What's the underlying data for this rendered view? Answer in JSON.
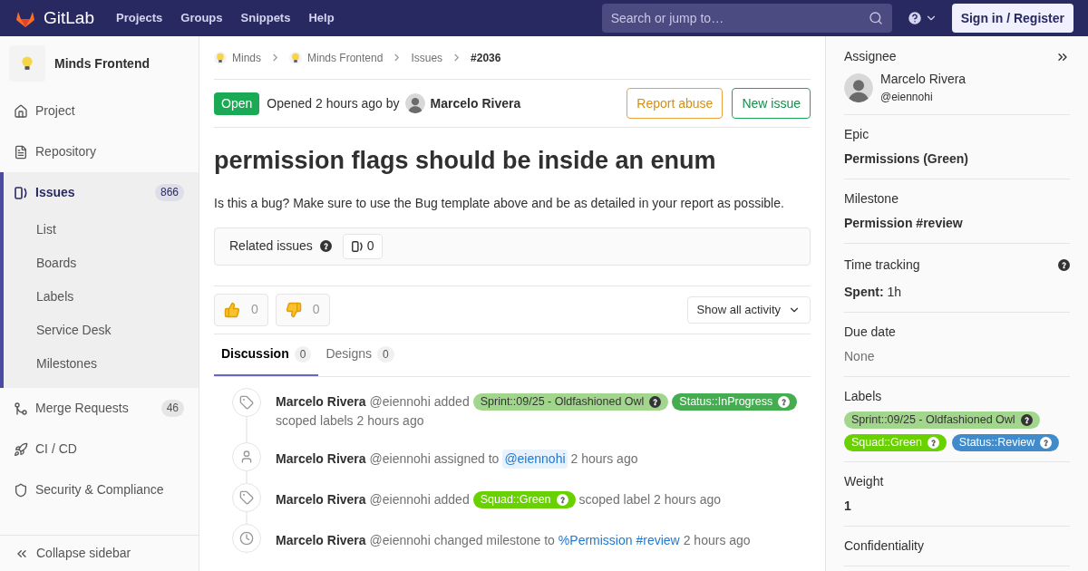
{
  "topbar": {
    "brand": "GitLab",
    "nav": [
      "Projects",
      "Groups",
      "Snippets",
      "Help"
    ],
    "search": {
      "placeholder": "Search or jump to…"
    },
    "sign_in": "Sign in / Register"
  },
  "sidebar": {
    "project": "Minds Frontend",
    "items": [
      {
        "label": "Project",
        "selected": false
      },
      {
        "label": "Repository",
        "selected": false
      },
      {
        "label": "Issues",
        "count": "866",
        "selected": true,
        "children": [
          {
            "label": "List"
          },
          {
            "label": "Boards"
          },
          {
            "label": "Labels"
          },
          {
            "label": "Service Desk"
          },
          {
            "label": "Milestones"
          }
        ]
      },
      {
        "label": "Merge Requests",
        "count": "46",
        "selected": false
      },
      {
        "label": "CI / CD",
        "selected": false
      },
      {
        "label": "Security & Compliance",
        "selected": false
      }
    ],
    "collapse": "Collapse sidebar"
  },
  "breadcrumbs": [
    {
      "label": "Minds",
      "avatar": true,
      "current": false
    },
    {
      "label": "Minds Frontend",
      "avatar": true,
      "current": false
    },
    {
      "label": "Issues",
      "avatar": false,
      "current": false
    },
    {
      "label": "#2036",
      "avatar": false,
      "current": true
    }
  ],
  "issue": {
    "status": "Open",
    "opened": "Opened 2 hours ago by",
    "author": "Marcelo Rivera",
    "actions": [
      {
        "label": "Report abuse",
        "kind": "warning"
      },
      {
        "label": "New issue",
        "kind": "success"
      }
    ],
    "title": "permission flags should be inside an enum",
    "description": "Is this a bug? Make sure to use the Bug template above and be as detailed in your report as possible.",
    "related": {
      "label": "Related issues",
      "count": "0"
    },
    "reactions": [
      {
        "kind": "up",
        "count": "0"
      },
      {
        "kind": "down",
        "count": "0"
      }
    ],
    "filter": "Show all activity",
    "tabs": [
      {
        "label": "Discussion",
        "count": "0",
        "selected": true
      },
      {
        "label": "Designs",
        "count": "0",
        "selected": false
      }
    ],
    "activity": [
      {
        "kind": "labels",
        "author": "Marcelo Rivera",
        "handle": "@eiennohi",
        "parts": [
          {
            "kind": "text",
            "text": "added"
          },
          {
            "kind": "label",
            "text": "Sprint::09/25 - Oldfashioned Owl",
            "color": "#a3d68d"
          },
          {
            "kind": "label",
            "text": "Status::InProgress",
            "color": "#44ad50"
          },
          {
            "kind": "text",
            "text": "scoped labels 2 hours ago"
          }
        ]
      },
      {
        "kind": "assignee",
        "author": "Marcelo Rivera",
        "handle": "@eiennohi",
        "parts": [
          {
            "kind": "text",
            "text": "assigned to"
          },
          {
            "kind": "mention",
            "text": "@eiennohi"
          },
          {
            "kind": "text",
            "text": "2 hours ago"
          }
        ]
      },
      {
        "kind": "labels",
        "author": "Marcelo Rivera",
        "handle": "@eiennohi",
        "parts": [
          {
            "kind": "text",
            "text": "added"
          },
          {
            "kind": "label",
            "text": "Squad::Green",
            "color": "#69d100"
          },
          {
            "kind": "text",
            "text": "scoped label 2 hours ago"
          }
        ]
      },
      {
        "kind": "milestone",
        "author": "Marcelo Rivera",
        "handle": "@eiennohi",
        "parts": [
          {
            "kind": "text",
            "text": "changed milestone to"
          },
          {
            "kind": "link",
            "text": "%Permission #review"
          },
          {
            "kind": "text",
            "text": "2 hours ago"
          }
        ]
      }
    ]
  },
  "right": {
    "assignee": {
      "title": "Assignee",
      "name": "Marcelo Rivera",
      "handle": "@eiennohi"
    },
    "sections": [
      {
        "kind": "value",
        "title": "Epic",
        "value": "Permissions (Green)"
      },
      {
        "kind": "value",
        "title": "Milestone",
        "value": "Permission #review"
      },
      {
        "kind": "time",
        "title": "Time tracking",
        "key": "Spent:",
        "value": "1h"
      },
      {
        "kind": "muted",
        "title": "Due date",
        "value": "None"
      },
      {
        "kind": "labels",
        "title": "Labels",
        "labels": [
          {
            "text": "Sprint::09/25 - Oldfashioned Owl",
            "color": "#a3d68d"
          },
          {
            "text": "Squad::Green",
            "color": "#69d100"
          },
          {
            "text": "Status::Review",
            "color": "#428bca"
          }
        ]
      },
      {
        "kind": "value",
        "title": "Weight",
        "value": "1"
      },
      {
        "kind": "title",
        "title": "Confidentiality"
      }
    ]
  }
}
